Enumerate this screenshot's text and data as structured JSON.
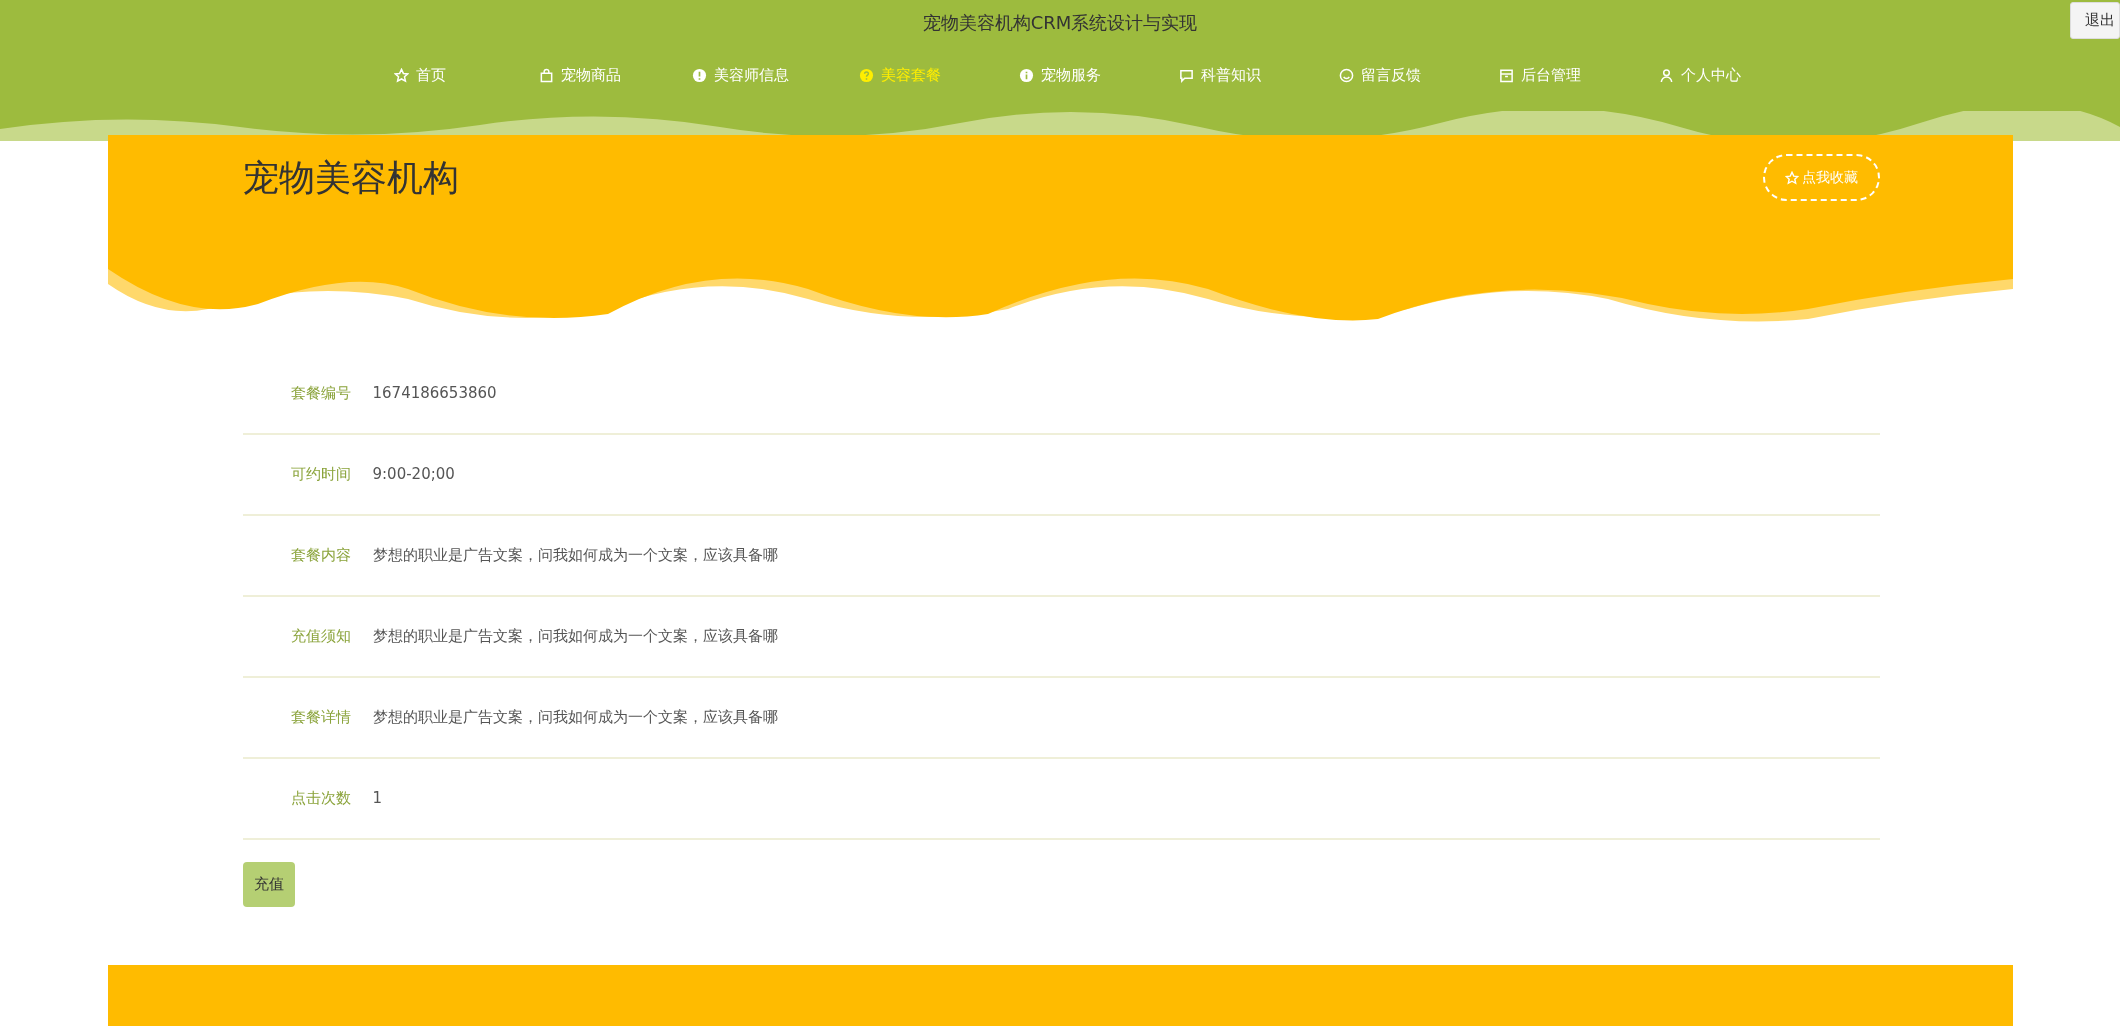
{
  "header": {
    "title": "宠物美容机构CRM系统设计与实现",
    "logout_button": "退出"
  },
  "nav": [
    {
      "label": "首页",
      "selected": false
    },
    {
      "label": "宠物商品",
      "selected": false
    },
    {
      "label": "美容师信息",
      "selected": false
    },
    {
      "label": "美容套餐",
      "selected": true
    },
    {
      "label": "宠物服务",
      "selected": false
    },
    {
      "label": "科普知识",
      "selected": false
    },
    {
      "label": "留言反馈",
      "selected": false
    },
    {
      "label": "后台管理",
      "selected": false
    },
    {
      "label": "个人中心",
      "selected": false
    }
  ],
  "banner": {
    "title": "宠物美容机构",
    "favorite_button": "点我收藏"
  },
  "details": [
    {
      "label": "套餐编号",
      "value": "1674186653860"
    },
    {
      "label": "可约时间",
      "value": "9:00-20;00"
    },
    {
      "label": "套餐内容",
      "value": "梦想的职业是广告文案，问我如何成为一个文案，应该具备哪"
    },
    {
      "label": "充值须知",
      "value": "梦想的职业是广告文案，问我如何成为一个文案，应该具备哪"
    },
    {
      "label": "套餐详情",
      "value": "梦想的职业是广告文案，问我如何成为一个文案，应该具备哪"
    },
    {
      "label": "点击次数",
      "value": "1"
    }
  ],
  "recharge_button": "充值"
}
